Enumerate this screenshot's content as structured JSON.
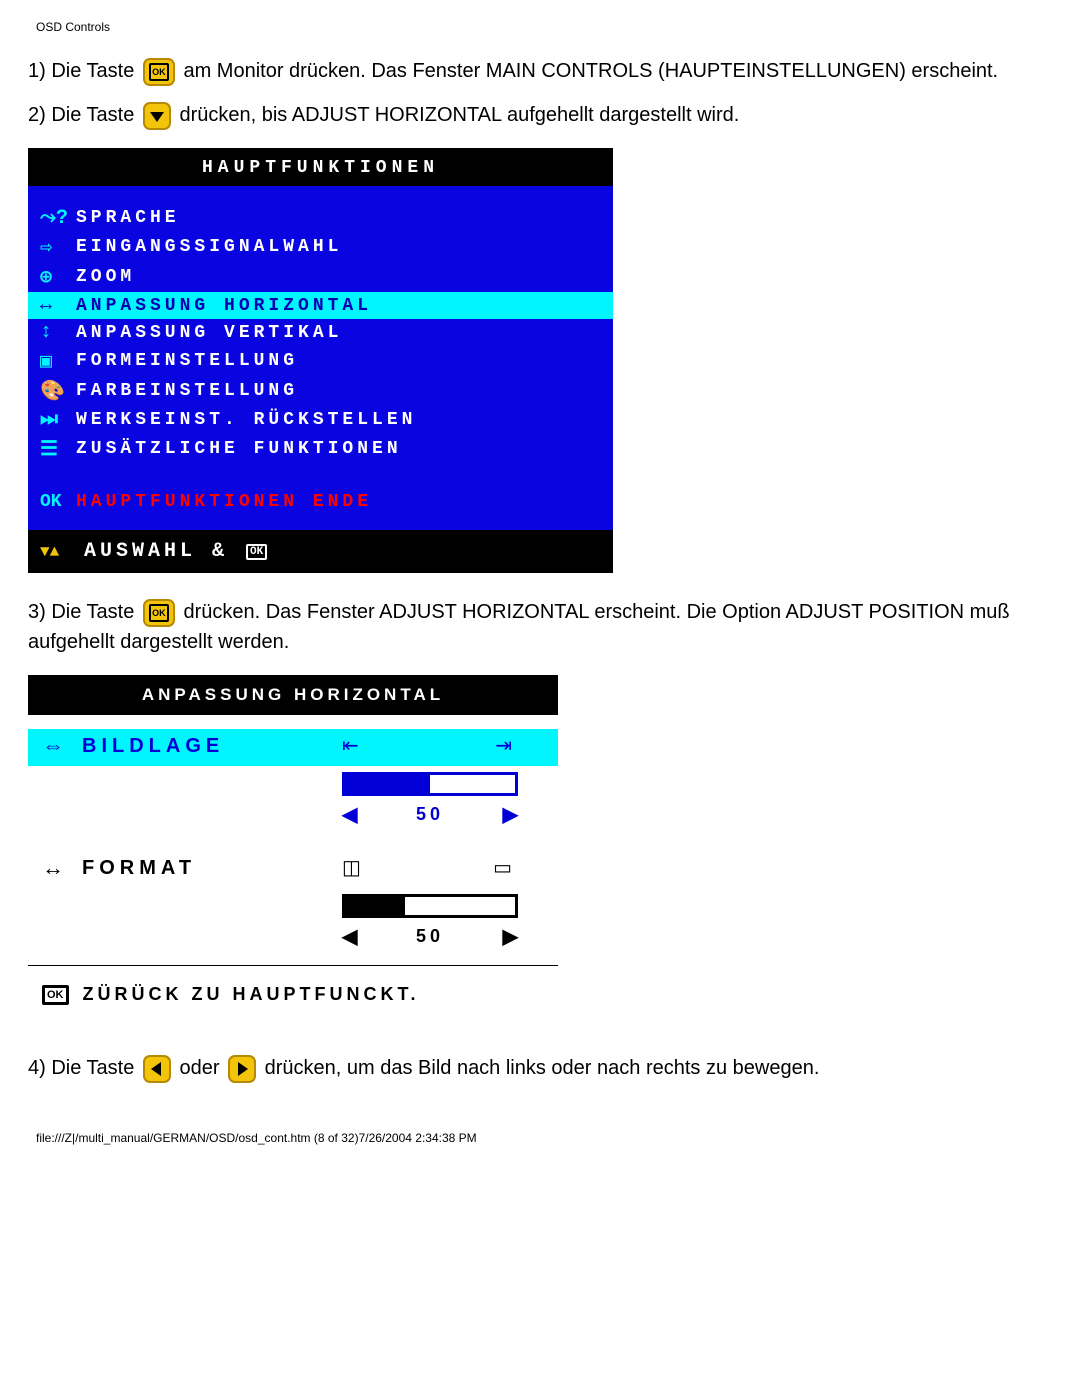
{
  "header": "OSD Controls",
  "step1": {
    "pre": "1) Die Taste ",
    "post": " am Monitor drücken. Das Fenster MAIN CONTROLS (HAUPTEINSTELLUNGEN) erscheint."
  },
  "step2": {
    "pre": "2) Die Taste ",
    "post": " drücken, bis ADJUST HORIZONTAL aufgehellt dargestellt wird."
  },
  "osd1": {
    "title": "HAUPTFUNKTIONEN",
    "items": [
      {
        "icon": "⤳?",
        "label": "SPRACHE"
      },
      {
        "icon": "⇨",
        "label": "EINGANGSSIGNALWAHL"
      },
      {
        "icon": "⊕",
        "label": "ZOOM"
      },
      {
        "icon": "↔",
        "label": "ANPASSUNG HORIZONTAL",
        "selected": true
      },
      {
        "icon": "↕",
        "label": "ANPASSUNG VERTIKAL"
      },
      {
        "icon": "▣",
        "label": "FORMEINSTELLUNG"
      },
      {
        "icon": "🎨",
        "label": "FARBEINSTELLUNG"
      },
      {
        "icon": "⏭",
        "label": "WERKSEINST. RÜCKSTELLEN"
      },
      {
        "icon": "☰",
        "label": "ZUSÄTZLICHE FUNKTIONEN"
      }
    ],
    "exit": {
      "icon": "OK",
      "label": "HAUPTFUNKTIONEN ENDE"
    },
    "footer": {
      "arrows": "▼▲",
      "label": "AUSWAHL &",
      "ok": "OK"
    }
  },
  "step3": {
    "pre": "3) Die Taste ",
    "post": " drücken. Das Fenster ADJUST HORIZONTAL erscheint. Die Option ADJUST POSITION muß aufgehellt dargestellt werden."
  },
  "osd2": {
    "title": "ANPASSUNG HORIZONTAL",
    "rows": [
      {
        "icon": "⇔",
        "label": "BILDLAGE",
        "value": "50",
        "fill": 50,
        "selected": true
      },
      {
        "icon": "↔",
        "label": "FORMAT",
        "value": "50",
        "fill": 35,
        "selected": false
      }
    ],
    "back": {
      "ok": "OK",
      "label": "ZÜRÜCK ZU HAUPTFUNCKT."
    }
  },
  "step4": {
    "pre": "4) Die Taste ",
    "mid": " oder ",
    "post": " drücken, um das Bild nach links oder nach rechts zu bewegen."
  },
  "footer": "file:///Z|/multi_manual/GERMAN/OSD/osd_cont.htm (8 of 32)7/26/2004 2:34:38 PM"
}
